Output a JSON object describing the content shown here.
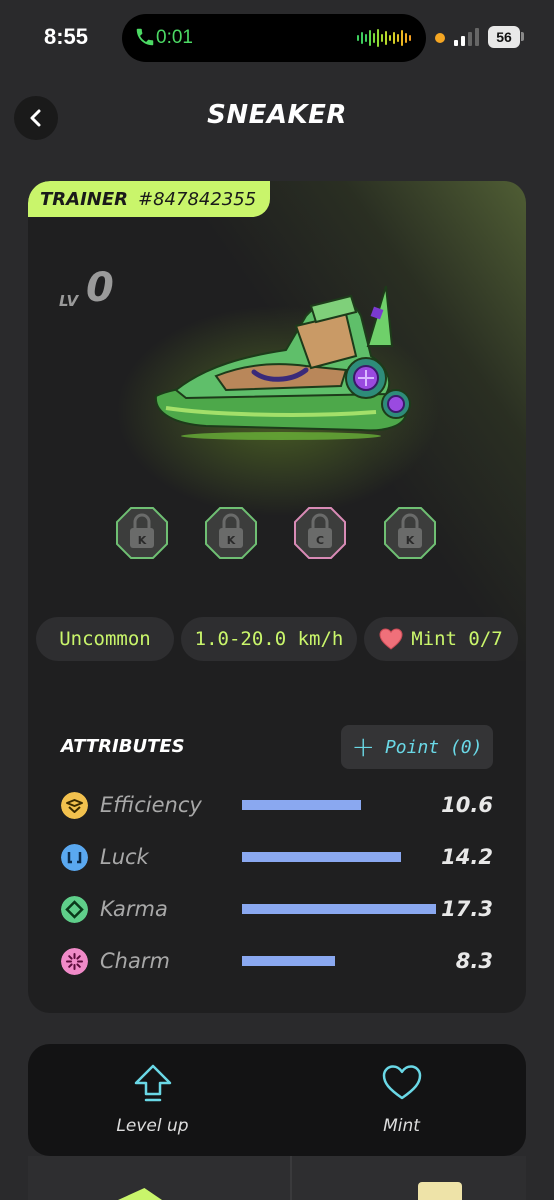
{
  "status_bar": {
    "time": "8:55",
    "call_duration": "0:01",
    "battery": "56",
    "call_color": "#4cd964"
  },
  "header": {
    "title": "SNEAKER",
    "back_icon": "chevron-left-icon"
  },
  "sneaker": {
    "type": "TRAINER",
    "id": "#847842355",
    "level_label": "LV",
    "level": "0",
    "accent_color": "#c9f56b",
    "sockets": [
      {
        "letter": "K",
        "locked": true,
        "color": "#6fbf73"
      },
      {
        "letter": "K",
        "locked": true,
        "color": "#6fbf73"
      },
      {
        "letter": "C",
        "locked": true,
        "color": "#d98bb6"
      },
      {
        "letter": "K",
        "locked": true,
        "color": "#6fbf73"
      }
    ],
    "rarity": "Uncommon",
    "speed_range": "1.0-20.0 km/h",
    "mint": "Mint 0/7"
  },
  "attributes": {
    "title": "ATTRIBUTES",
    "point_button": "Point (0)",
    "bar_max": 17.3,
    "items": [
      {
        "name": "Efficiency",
        "value": "10.6",
        "icon": "efficiency-icon",
        "color": "#f2c14e"
      },
      {
        "name": "Luck",
        "value": "14.2",
        "icon": "luck-icon",
        "color": "#5aa8f0"
      },
      {
        "name": "Karma",
        "value": "17.3",
        "icon": "karma-icon",
        "color": "#5fcf8a"
      },
      {
        "name": "Charm",
        "value": "8.3",
        "icon": "charm-icon",
        "color": "#f08ac8"
      }
    ],
    "bar_color": "#8aa8f0"
  },
  "actions": {
    "level_up": "Level up",
    "mint": "Mint",
    "icon_color": "#6ad8e6"
  }
}
